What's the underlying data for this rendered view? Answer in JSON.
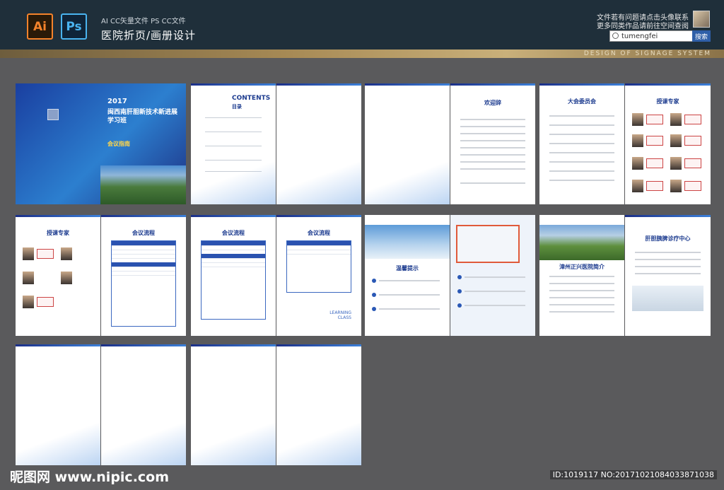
{
  "header": {
    "sub_label": "AI CC矢量文件   PS CC文件",
    "title": "医院折页/画册设计",
    "ai_logo": "Ai",
    "ps_logo": "Ps",
    "notice_line1": "文件若有问题请点击头像联系",
    "notice_line2": "更多同类作品请前往空间查阅",
    "search_value": "tumengfei",
    "search_button": "搜索",
    "band_text": "DESIGN OF SIGNAGE SYSTEM"
  },
  "pages": {
    "cover_year": "2017",
    "cover_title": "闽西南肝胆新技术新进展学习班",
    "cover_guide": "会议指南",
    "contents_label": "CONTENTS",
    "contents_sub": "目录",
    "welcome_title": "欢迎辞",
    "committee_title": "大会委员会",
    "experts_title": "授课专家",
    "agenda_title": "会议流程",
    "tips_title": "温馨提示",
    "hospital_intro": "漳州正兴医院简介",
    "center_title": "肝胆胰脾诊疗中心",
    "learning": "LEARNING",
    "class": "CLASS"
  },
  "footer": {
    "watermark": "昵图网 www.nipic.com",
    "id_text": "ID:1019117 NO:20171021084033871038"
  }
}
